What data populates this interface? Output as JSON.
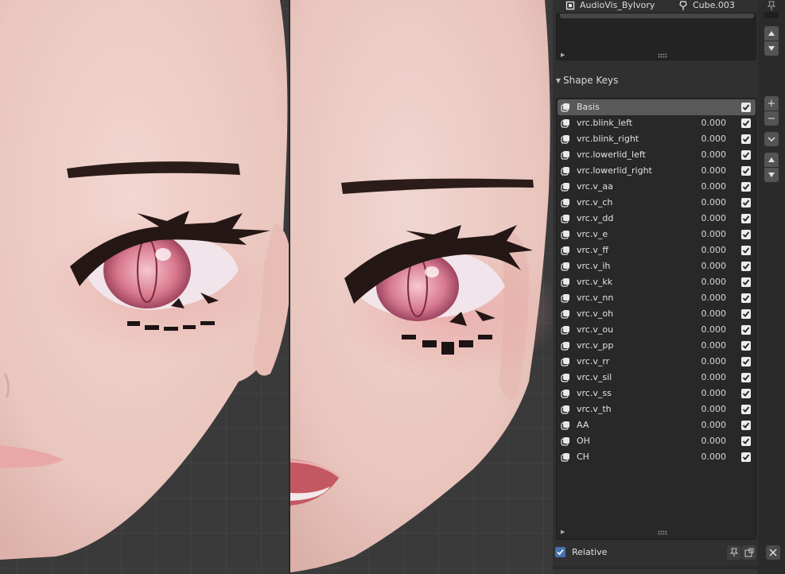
{
  "header": {
    "armature_name": "AudioVis_ByIvory",
    "mesh_name": "Cube.003",
    "armature_icon": "armature-object-icon",
    "mesh_icon": "mesh-data-icon",
    "pin_icon": "pin-icon"
  },
  "shape_keys": {
    "section_title": "Shape Keys",
    "items": [
      {
        "name": "Basis",
        "value": "",
        "active": true,
        "enabled": true
      },
      {
        "name": "vrc.blink_left",
        "value": "0.000",
        "enabled": true
      },
      {
        "name": "vrc.blink_right",
        "value": "0.000",
        "enabled": true
      },
      {
        "name": "vrc.lowerlid_left",
        "value": "0.000",
        "enabled": true
      },
      {
        "name": "vrc.lowerlid_right",
        "value": "0.000",
        "enabled": true
      },
      {
        "name": "vrc.v_aa",
        "value": "0.000",
        "enabled": true
      },
      {
        "name": "vrc.v_ch",
        "value": "0.000",
        "enabled": true
      },
      {
        "name": "vrc.v_dd",
        "value": "0.000",
        "enabled": true
      },
      {
        "name": "vrc.v_e",
        "value": "0.000",
        "enabled": true
      },
      {
        "name": "vrc.v_ff",
        "value": "0.000",
        "enabled": true
      },
      {
        "name": "vrc.v_ih",
        "value": "0.000",
        "enabled": true
      },
      {
        "name": "vrc.v_kk",
        "value": "0.000",
        "enabled": true
      },
      {
        "name": "vrc.v_nn",
        "value": "0.000",
        "enabled": true
      },
      {
        "name": "vrc.v_oh",
        "value": "0.000",
        "enabled": true
      },
      {
        "name": "vrc.v_ou",
        "value": "0.000",
        "enabled": true
      },
      {
        "name": "vrc.v_pp",
        "value": "0.000",
        "enabled": true
      },
      {
        "name": "vrc.v_rr",
        "value": "0.000",
        "enabled": true
      },
      {
        "name": "vrc.v_sil",
        "value": "0.000",
        "enabled": true
      },
      {
        "name": "vrc.v_ss",
        "value": "0.000",
        "enabled": true
      },
      {
        "name": "vrc.v_th",
        "value": "0.000",
        "enabled": true
      },
      {
        "name": "AA",
        "value": "0.000",
        "enabled": true
      },
      {
        "name": "OH",
        "value": "0.000",
        "enabled": true
      },
      {
        "name": "CH",
        "value": "0.000",
        "enabled": true
      }
    ],
    "side_buttons": {
      "add": "+",
      "remove": "−"
    },
    "relative_label": "Relative",
    "relative_checked": true
  },
  "colors": {
    "accent": "#4772b3",
    "panel_bg": "#303030",
    "list_bg": "#282828",
    "active_row": "#595959",
    "skin": "#eccbc4"
  }
}
